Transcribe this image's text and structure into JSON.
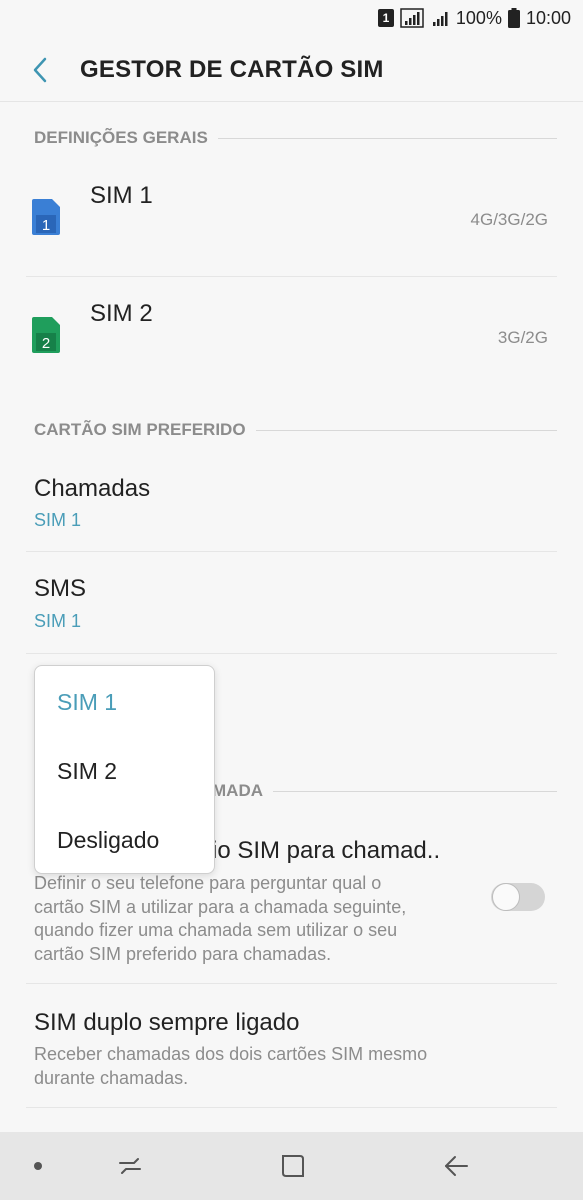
{
  "status_bar": {
    "sim_badge": "1",
    "battery": "100%",
    "time": "10:00"
  },
  "header": {
    "title": "GESTOR DE CARTÃO SIM",
    "back_icon": "chevron-left-icon"
  },
  "general": {
    "section_title": "DEFINIÇÕES GERAIS",
    "sims": [
      {
        "name": "SIM 1",
        "badge": "1",
        "network": "4G/3G/2G",
        "color": "#3a7fd5"
      },
      {
        "name": "SIM 2",
        "badge": "2",
        "network": "3G/2G",
        "color": "#1f9e5c"
      }
    ]
  },
  "preferred": {
    "section_title": "CARTÃO SIM PREFERIDO",
    "calls": {
      "title": "Chamadas",
      "value": "SIM 1"
    },
    "sms": {
      "title": "SMS",
      "value": "SIM 1"
    }
  },
  "calls_section": {
    "section_title_partial": "MADA",
    "ask_title_partial": "io SIM para chamad..",
    "ask_desc": [
      "Definir o seu telefone para perguntar qual o",
      "cartão SIM a utilizar para a chamada seguinte,",
      "quando fizer uma chamada sem utilizar o seu",
      "cartão SIM preferido para chamadas."
    ],
    "ask_toggle_on": false,
    "dual_title": "SIM duplo sempre ligado",
    "dual_desc": [
      "Receber chamadas dos dois cartões SIM mesmo",
      "durante chamadas."
    ]
  },
  "dropdown": {
    "options": [
      "SIM 1",
      "SIM 2",
      "Desligado"
    ],
    "selected_index": 0
  },
  "colors": {
    "accent": "#4a9db8",
    "background": "#f7f7f7"
  }
}
